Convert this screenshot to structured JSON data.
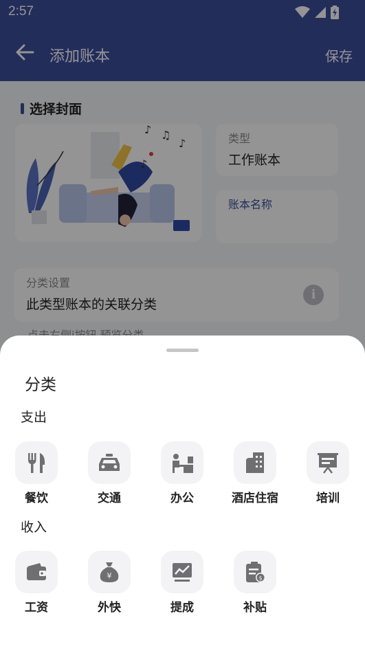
{
  "status": {
    "time": "2:57"
  },
  "appbar": {
    "title": "添加账本",
    "save_label": "保存"
  },
  "form": {
    "cover_section_title": "选择封面",
    "type_label": "类型",
    "type_value": "工作账本",
    "name_label": "账本名称",
    "name_value": "",
    "category_label": "分类设置",
    "category_value": "此类型账本的关联分类",
    "hint": "点击右侧i按钮 预览分类"
  },
  "sheet": {
    "title": "分类",
    "expense_label": "支出",
    "income_label": "收入",
    "expense": [
      {
        "name": "餐饮",
        "icon": "utensils-icon"
      },
      {
        "name": "交通",
        "icon": "taxi-icon"
      },
      {
        "name": "办公",
        "icon": "office-desk-icon"
      },
      {
        "name": "酒店住宿",
        "icon": "hotel-icon"
      },
      {
        "name": "培训",
        "icon": "presentation-board-icon"
      }
    ],
    "income": [
      {
        "name": "工资",
        "icon": "wallet-icon"
      },
      {
        "name": "外快",
        "icon": "money-bag-icon"
      },
      {
        "name": "提成",
        "icon": "trend-chart-icon"
      },
      {
        "name": "补贴",
        "icon": "allowance-clipboard-icon"
      }
    ]
  },
  "colors": {
    "primary": "#3b4f9b",
    "icon_gray": "#6f6f73",
    "tile_bg": "#f3f3f5"
  }
}
